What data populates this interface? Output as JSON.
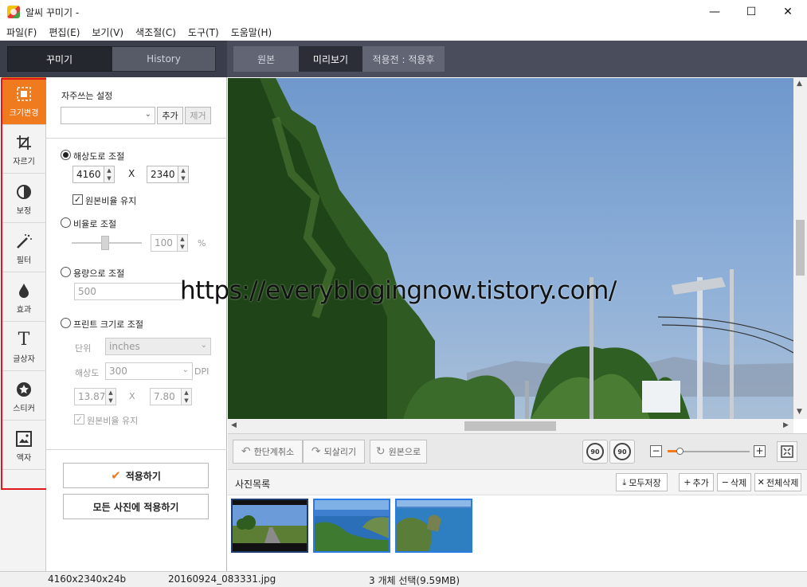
{
  "window": {
    "title": "알씨 꾸미기 -",
    "minimize": "—",
    "maximize": "☐",
    "close": "✕"
  },
  "menu": [
    "파일(F)",
    "편집(E)",
    "보기(V)",
    "색조절(C)",
    "도구(T)",
    "도움말(H)"
  ],
  "left_tabs": {
    "decorate": "꾸미기",
    "history": "History"
  },
  "view_tabs": {
    "original": "원본",
    "preview": "미리보기",
    "compare": "적용전 : 적용후"
  },
  "tools": [
    {
      "label": "크기변경",
      "icon": "resize-icon"
    },
    {
      "label": "자르기",
      "icon": "crop-icon"
    },
    {
      "label": "보정",
      "icon": "adjust-icon"
    },
    {
      "label": "필터",
      "icon": "filter-wand-icon"
    },
    {
      "label": "효과",
      "icon": "drop-icon"
    },
    {
      "label": "글상자",
      "icon": "text-icon"
    },
    {
      "label": "스티커",
      "icon": "sticker-icon"
    },
    {
      "label": "액자",
      "icon": "frame-icon"
    }
  ],
  "resize": {
    "favorites_label": "자주쓰는 설정",
    "favorites_value": "",
    "add_button": "추가",
    "remove_button": "제거",
    "by_resolution": "해상도로 조절",
    "width": "4160",
    "x": "X",
    "height": "2340",
    "keep_ratio": "원본비율 유지",
    "by_ratio": "비율로 조절",
    "ratio_value": "100",
    "ratio_unit": "%",
    "by_size": "용량으로 조절",
    "size_value": "500",
    "by_print": "프린트 크기로 조절",
    "unit_label": "단위",
    "unit_value": "inches",
    "dpi_label": "해상도",
    "dpi_value": "300",
    "dpi_unit": "DPI",
    "print_width": "13.87",
    "print_height": "7.80",
    "print_keep_ratio": "원본비율 유지",
    "apply_button": "적용하기",
    "apply_all_button": "모든 사진에 적용하기"
  },
  "controls": {
    "undo": "한단계취소",
    "redo": "되살리기",
    "revert": "원본으로",
    "rotate_left": "90",
    "rotate_right": "90",
    "zoom_level": 0.15
  },
  "photo_list": {
    "title": "사진목록",
    "save_all": "모두저장",
    "add": "추가",
    "delete": "삭제",
    "delete_all": "전체삭제"
  },
  "status": {
    "dimensions": "4160x2340x24b",
    "filename": "20160924_083331.jpg",
    "selection": "3 개체 선택(9.59MB)"
  },
  "watermark": "https://everyblogingnow.tistory.com/",
  "colors": {
    "accent": "#f07a1e",
    "highlight_border": "#e0171b",
    "dark_bar": "#3a3d4a",
    "selection_blue": "#2a7be4"
  }
}
